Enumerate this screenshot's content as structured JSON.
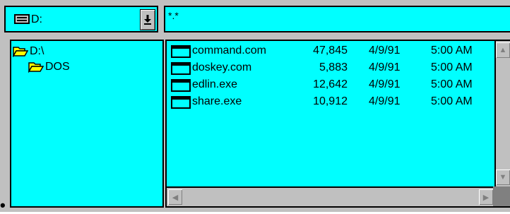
{
  "drive": {
    "label": "D:",
    "icon": "drive-icon",
    "dropdown_icon": "arrow-down-icon"
  },
  "filter": {
    "pattern": "*.*"
  },
  "tree": {
    "items": [
      {
        "label": "D:\\",
        "icon": "open-folder-icon"
      },
      {
        "label": "DOS",
        "icon": "open-folder-icon"
      }
    ]
  },
  "files": {
    "rows": [
      {
        "name": "command.com",
        "size": "47,845",
        "date": "4/9/91",
        "time": "5:00 AM"
      },
      {
        "name": "doskey.com",
        "size": "5,883",
        "date": "4/9/91",
        "time": "5:00 AM"
      },
      {
        "name": "edlin.exe",
        "size": "12,642",
        "date": "4/9/91",
        "time": "5:00 AM"
      },
      {
        "name": "share.exe",
        "size": "10,912",
        "date": "4/9/91",
        "time": "5:00 AM"
      }
    ]
  },
  "colors": {
    "pane_bg": "#00ffff",
    "chrome": "#c0c0c0",
    "border": "#000000"
  }
}
